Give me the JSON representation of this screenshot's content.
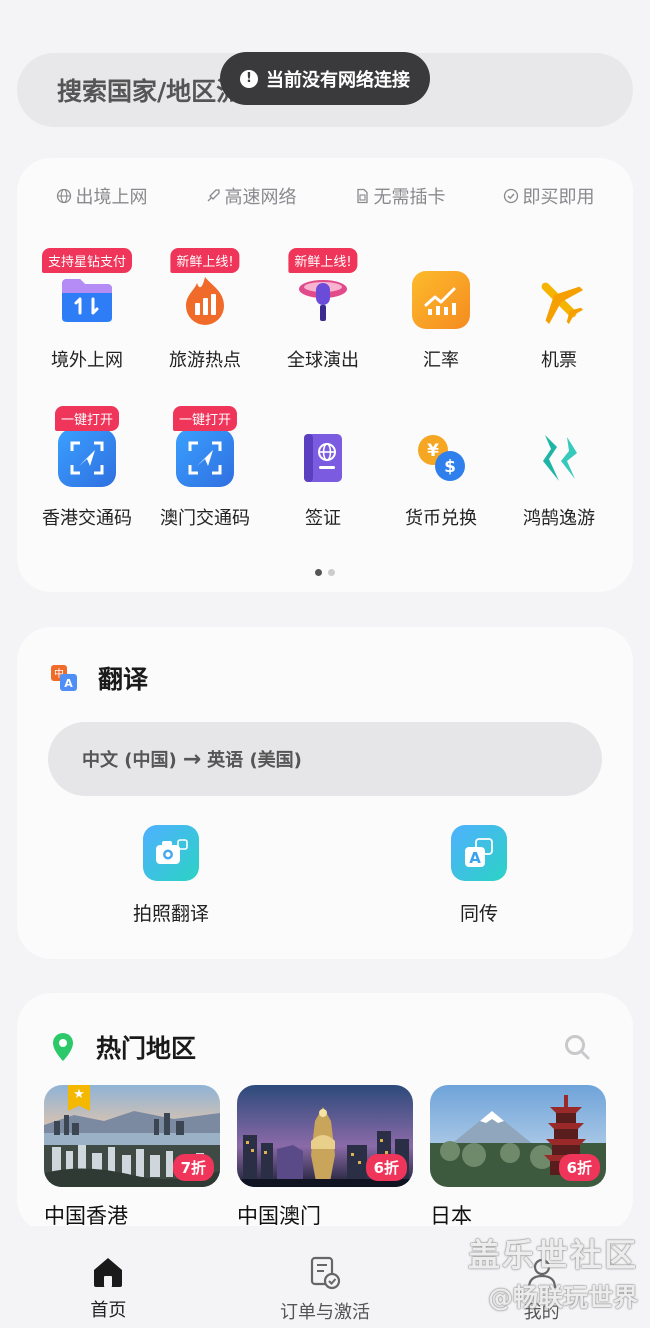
{
  "search": {
    "placeholder": "搜索国家/地区流量套餐"
  },
  "toast": {
    "text": "当前没有网络连接"
  },
  "features": [
    {
      "icon": "globe-icon",
      "label": "出境上网"
    },
    {
      "icon": "rocket-icon",
      "label": "高速网络"
    },
    {
      "icon": "sim-icon",
      "label": "无需插卡"
    },
    {
      "icon": "check-circle-icon",
      "label": "即买即用"
    }
  ],
  "services": [
    {
      "label": "境外上网",
      "badge": "支持星钻支付",
      "icon": "folder-transfer-icon",
      "color": "#2f7df6"
    },
    {
      "label": "旅游热点",
      "badge": "新鲜上线!",
      "icon": "fire-chart-icon",
      "color": "#f06a2a"
    },
    {
      "label": "全球演出",
      "badge": "新鲜上线!",
      "icon": "microphone-icon",
      "color": "#d6336c"
    },
    {
      "label": "汇率",
      "badge": "",
      "icon": "chart-icon",
      "color": "#f7a21b"
    },
    {
      "label": "机票",
      "badge": "",
      "icon": "airplane-icon",
      "color": "#f5b400"
    },
    {
      "label": "香港交通码",
      "badge": "一键打开",
      "icon": "transit-code-icon",
      "color": "#2f80ed"
    },
    {
      "label": "澳门交通码",
      "badge": "一键打开",
      "icon": "transit-code-icon",
      "color": "#2f80ed"
    },
    {
      "label": "签证",
      "badge": "",
      "icon": "passport-icon",
      "color": "#6a4cd8"
    },
    {
      "label": "货币兑换",
      "badge": "",
      "icon": "currency-exchange-icon",
      "color": "#f5a623"
    },
    {
      "label": "鸿鹄逸游",
      "badge": "",
      "icon": "swan-logo-icon",
      "color": "#20b3a8"
    }
  ],
  "translate": {
    "title": "翻译",
    "from": "中文 (中国)",
    "arrow": "→",
    "to": "英语 (美国)",
    "actions": [
      {
        "label": "拍照翻译",
        "icon": "camera-translate-icon"
      },
      {
        "label": "同传",
        "icon": "simultaneous-translate-icon"
      }
    ]
  },
  "hot": {
    "title": "热门地区",
    "regions": [
      {
        "name": "中国香港",
        "discount": "7折",
        "featured": true
      },
      {
        "name": "中国澳门",
        "discount": "6折",
        "featured": false
      },
      {
        "name": "日本",
        "discount": "6折",
        "featured": false
      }
    ]
  },
  "tabs": [
    {
      "label": "首页",
      "icon": "home-icon",
      "active": true
    },
    {
      "label": "订单与激活",
      "icon": "order-icon",
      "active": false
    },
    {
      "label": "我的",
      "icon": "user-icon",
      "active": false
    }
  ],
  "watermark": {
    "line1": "盖乐世社区",
    "line2": "@畅联玩世界"
  }
}
